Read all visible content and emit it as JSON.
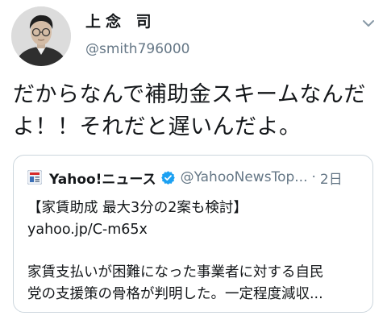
{
  "author": {
    "display_name": "上念 司",
    "handle": "@smith796000"
  },
  "tweet": {
    "text": "だからなんで補助金スキームなんだよ！！それだと遅いんだよ。"
  },
  "quoted": {
    "source_name": "Yahoo!ニュース",
    "source_handle": "@YahooNewsTop...",
    "separator": "·",
    "time": "2日",
    "headline": "【家賃助成 最大3分の2案も検討】",
    "link": "yahoo.jp/C-m65x",
    "body_line1": "家賃支払いが困難になった事業者に対する自民",
    "body_line2": "党の支援策の骨格が判明した。一定程度減収..."
  },
  "icons": {
    "avatar": "avatar",
    "menu": "chevron-down-icon",
    "source": "yahoo-news-icon",
    "verified": "verified-badge-icon"
  },
  "colors": {
    "text": "#14171a",
    "secondary": "#657786",
    "verified": "#1da1f2",
    "border": "#ccd6dd"
  }
}
